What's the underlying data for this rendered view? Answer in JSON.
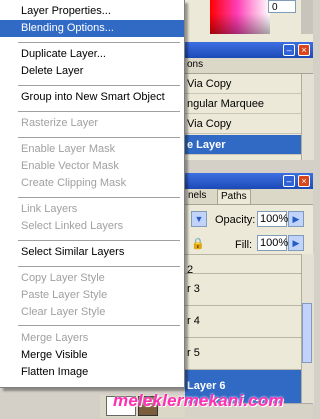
{
  "color_panel": {
    "value_field": "0"
  },
  "history_panel": {
    "tab_fragment": "ons",
    "rows": [
      "Via Copy",
      "ngular Marquee",
      "Via Copy",
      "e Layer"
    ],
    "active_index": 3
  },
  "layers_panel": {
    "tabs": [
      "nels",
      "Paths"
    ],
    "opacity_label": "Opacity:",
    "opacity_value": "100%",
    "fill_label": "Fill:",
    "fill_value": "100%",
    "layers": [
      "2",
      "r 3",
      "r 4",
      "r 5",
      "Layer 6"
    ],
    "active_index": 4
  },
  "context_menu": {
    "items": [
      {
        "label": "Layer Properties...",
        "enabled": true
      },
      {
        "label": "Blending Options...",
        "enabled": true,
        "highlighted": true
      },
      {
        "label": "Duplicate Layer...",
        "enabled": true
      },
      {
        "label": "Delete Layer",
        "enabled": true
      },
      {
        "label": "Group into New Smart Object",
        "enabled": true
      },
      {
        "label": "Rasterize Layer",
        "enabled": false
      },
      {
        "label": "Enable Layer Mask",
        "enabled": false
      },
      {
        "label": "Enable Vector Mask",
        "enabled": false
      },
      {
        "label": "Create Clipping Mask",
        "enabled": false
      },
      {
        "label": "Link Layers",
        "enabled": false
      },
      {
        "label": "Select Linked Layers",
        "enabled": false
      },
      {
        "label": "Select Similar Layers",
        "enabled": true
      },
      {
        "label": "Copy Layer Style",
        "enabled": false
      },
      {
        "label": "Paste Layer Style",
        "enabled": false
      },
      {
        "label": "Clear Layer Style",
        "enabled": false
      },
      {
        "label": "Merge Layers",
        "enabled": false
      },
      {
        "label": "Merge Visible",
        "enabled": true
      },
      {
        "label": "Flatten Image",
        "enabled": true
      }
    ]
  },
  "watermark": "meleklermekani.com",
  "colors": {
    "highlight": "#316ac5",
    "disabled_text": "#a0a0a0",
    "title_bar": "#1c4ab8",
    "watermark": "#ff2fb3"
  }
}
